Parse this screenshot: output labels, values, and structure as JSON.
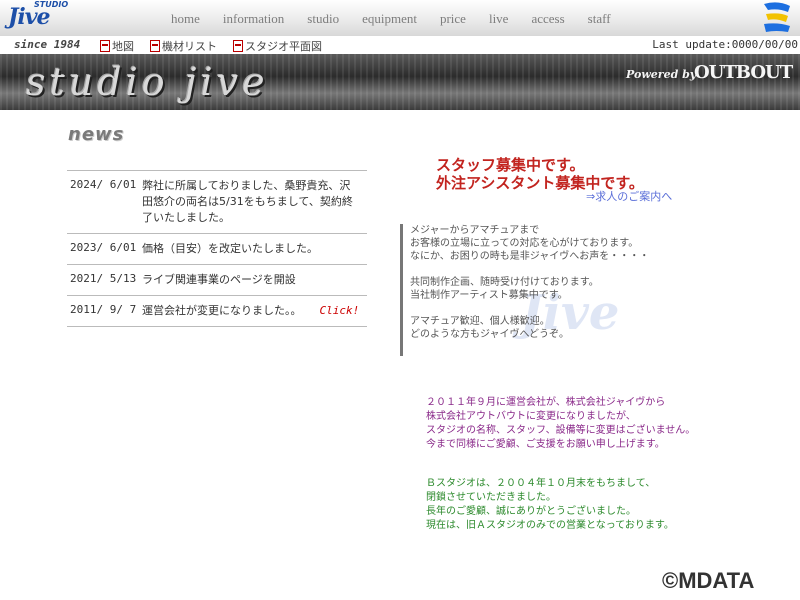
{
  "logo": {
    "small": "STUDIO",
    "main": "Jive"
  },
  "nav": [
    "home",
    "information",
    "studio",
    "equipment",
    "price",
    "live",
    "access",
    "staff"
  ],
  "subbar": {
    "since": "since 1984",
    "links": [
      "地図",
      "機材リスト",
      "スタジオ平面図"
    ],
    "update": "Last update:0000/00/00"
  },
  "banner": {
    "title": "studio jive",
    "powered": "Powered by",
    "company": "OUTBOUT"
  },
  "news": {
    "title": "news",
    "items": [
      {
        "date": "2024/ 6/01",
        "text": "弊社に所属しておりました、桑野貴充、沢田悠介の両名は5/31をもちまして、契約終了いたしました。"
      },
      {
        "date": "2023/ 6/01",
        "text": "価格（目安）を改定いたしました。"
      },
      {
        "date": "2021/ 5/13",
        "text": "ライブ関連事業のページを開設"
      },
      {
        "date": "2011/ 9/ 7",
        "text": "運営会社が変更になりました。。",
        "link": "Click!"
      }
    ]
  },
  "recruit": {
    "line1": "スタッフ募集中です。",
    "line2": "外注アシスタント募集中です。",
    "link": "⇒求人のご案内へ"
  },
  "intro": [
    "メジャーからアマチュアまで",
    "お客様の立場に立っての対応を心がけております。",
    "なにか、お困りの時も是非ジャイヴへお声を・・・・",
    "共同制作企画、随時受け付けております。",
    "当社制作アーティスト募集中です。",
    "アマチュア歓迎、個人様歓迎。",
    "どのような方もジャイヴへどうぞ。"
  ],
  "notice_purple": [
    "２０１１年９月に運営会社が、株式会社ジャイヴから",
    "株式会社アウトバウトに変更になりましたが、",
    "スタジオの名称、スタッフ、設備等に変更はございません。",
    "今まで同様にご愛顧、ご支援をお願い申し上げます。"
  ],
  "notice_green": [
    "Ｂスタジオは、２００４年１０月末をもちまして、",
    "閉鎖させていただきました。",
    "長年のご愛顧、誠にありがとうございました。",
    "現在は、旧Ａスタジオのみでの営業となっております。"
  ],
  "watermark": "Jive",
  "copyright": "©MDATA"
}
